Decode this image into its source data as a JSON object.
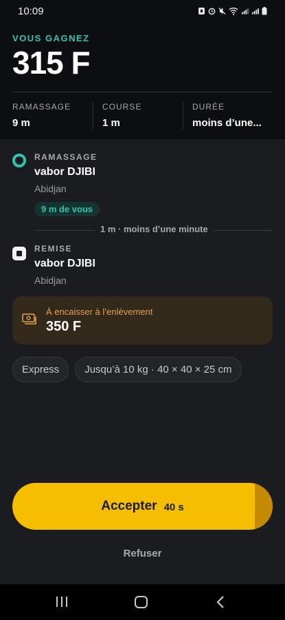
{
  "status_bar": {
    "time": "10:09"
  },
  "header": {
    "earn_label": "VOUS GAGNEZ",
    "earn_amount": "315 F",
    "stats": [
      {
        "label": "RAMASSAGE",
        "value": "9 m"
      },
      {
        "label": "COURSE",
        "value": "1 m"
      },
      {
        "label": "DURÉE",
        "value": "moins d’une..."
      }
    ]
  },
  "pickup": {
    "label": "RAMASSAGE",
    "name": "vabor DJIBI",
    "city": "Abidjan",
    "distance_badge": "9 m de vous"
  },
  "route_summary": "1 m · moins d’une minute",
  "dropoff": {
    "label": "REMISE",
    "name": "vabor DJIBI",
    "city": "Abidjan"
  },
  "cash": {
    "label": "À encaisser à l’enlèvement",
    "amount": "350 F",
    "icon": "cash-icon"
  },
  "chips": [
    "Express",
    "Jusqu’à 10 kg · 40 × 40 × 25 cm"
  ],
  "accept": {
    "label": "Accepter",
    "timer": "40 s",
    "remaining_fraction": 0.93
  },
  "refuse_label": "Refuser",
  "colors": {
    "accent_teal": "#2fc4b2",
    "accept_yellow": "#f5bf00",
    "cash_orange": "#e6a24a",
    "background": "#1b1c1f"
  }
}
